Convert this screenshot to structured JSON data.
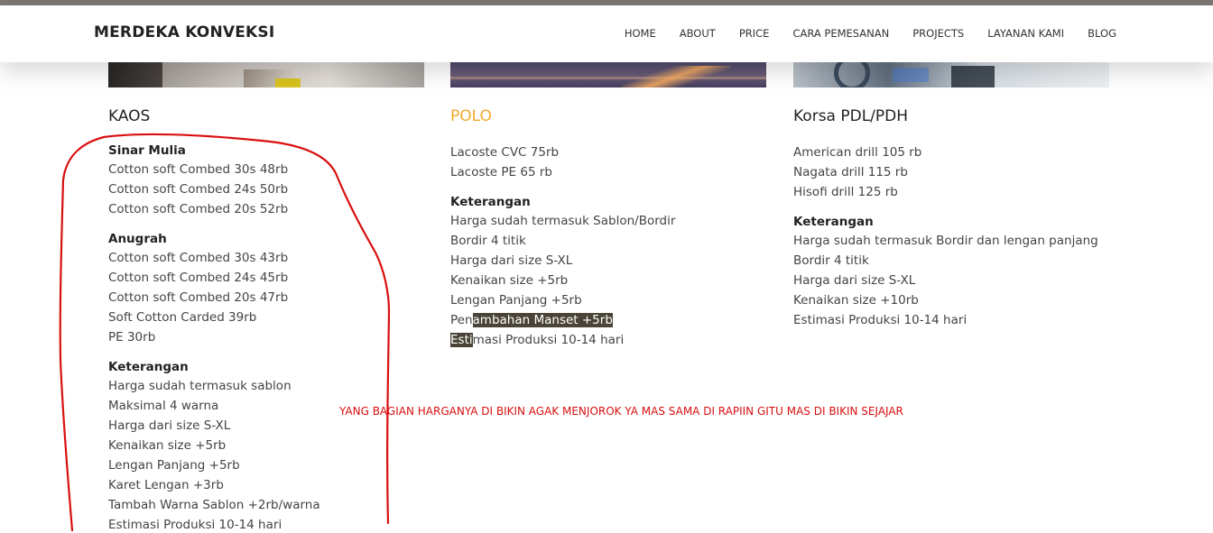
{
  "header": {
    "brand": "MERDEKA KONVEKSI",
    "nav": [
      "HOME",
      "ABOUT",
      "PRICE",
      "CARA PEMESANAN",
      "PROJECTS",
      "LAYANAN KAMI",
      "BLOG"
    ]
  },
  "kaos": {
    "title": "KAOS",
    "sinar_heading": "Sinar Mulia",
    "sinar_items": [
      "Cotton soft Combed 30s 48rb",
      "Cotton soft Combed 24s 50rb",
      "Cotton soft Combed 20s 52rb"
    ],
    "anugrah_heading": "Anugrah",
    "anugrah_items": [
      "Cotton soft Combed 30s 43rb",
      "Cotton soft Combed 24s 45rb",
      "Cotton soft Combed 20s 47rb",
      "Soft Cotton Carded 39rb",
      "PE 30rb"
    ],
    "keterangan_heading": "Keterangan",
    "keterangan_items": [
      "Harga sudah termasuk sablon",
      "Maksimal 4 warna",
      "Harga dari size S-XL",
      "Kenaikan size +5rb",
      "Lengan Panjang +5rb",
      "Karet Lengan +3rb",
      "Tambah Warna Sablon +2rb/warna",
      "Estimasi Produksi 10-14 hari"
    ]
  },
  "polo": {
    "title": "POLO",
    "items": [
      "Lacoste CVC 75rb",
      "Lacoste PE 65 rb"
    ],
    "keterangan_heading": "Keterangan",
    "keterangan_items": [
      "Harga sudah termasuk Sablon/Bordir",
      "Bordir 4 titik",
      "Harga dari size S-XL",
      "Kenaikan size +5rb",
      "Lengan Panjang +5rb"
    ],
    "manset_a": "Pen",
    "manset_b": "ambahan Manset +5rb",
    "estimasi_a": "Esti",
    "estimasi_b": "masi Produksi 10-14 hari"
  },
  "korsa": {
    "title": "Korsa PDL/PDH",
    "items": [
      "American drill 105 rb",
      "Nagata drill 115 rb",
      "Hisofi drill 125 rb"
    ],
    "keterangan_heading": "Keterangan",
    "keterangan_items": [
      "Harga sudah termasuk Bordir dan lengan panjang",
      "Bordir 4 titik",
      "Harga dari size S-XL",
      "Kenaikan size +10rb",
      "Estimasi Produksi 10-14 hari"
    ]
  },
  "annotation": {
    "note": "YANG BAGIAN HARGANYA DI BIKIN AGAK MENJOROK YA MAS SAMA DI RAPIIN GITU MAS DI BIKIN SEJAJAR",
    "color": "#d90f0f"
  },
  "colors": {
    "accent": "#f0a92c",
    "highlight": "#4a4438"
  }
}
